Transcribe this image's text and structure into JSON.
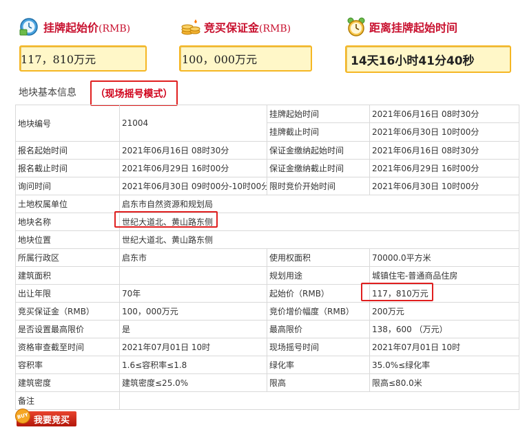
{
  "stats": [
    {
      "title": "挂牌起始价",
      "unit": "(RMB)",
      "value": "117，810万元",
      "icon": "money-clock-icon"
    },
    {
      "title": "竞买保证金",
      "unit": "(RMB)",
      "value": "100，000万元",
      "icon": "coin-stack-icon"
    },
    {
      "title": "距离挂牌起始时间",
      "unit": "",
      "value": "14天16小时41分40秒",
      "icon": "alarm-clock-icon"
    }
  ],
  "section": {
    "title": "地块基本信息",
    "mode": "（现场摇号模式）"
  },
  "table": {
    "parcel_no_label": "地块编号",
    "parcel_no": "21004",
    "listing_start_label": "挂牌起始时间",
    "listing_start": "2021年06月16日 08时30分",
    "listing_end_label": "挂牌截止时间",
    "listing_end": "2021年06月30日 10时00分",
    "rows": [
      {
        "l1": "报名起始时间",
        "v1": "2021年06月16日 08时30分",
        "l2": "保证金缴纳起始时间",
        "v2": "2021年06月16日 08时30分"
      },
      {
        "l1": "报名截止时间",
        "v1": "2021年06月29日 16时00分",
        "l2": "保证金缴纳截止时间",
        "v2": "2021年06月29日 16时00分"
      },
      {
        "l1": "询问时间",
        "v1": "2021年06月30日 09时00分-10时00分",
        "l2": "限时竞价开始时间",
        "v2": "2021年06月30日 10时00分"
      }
    ],
    "wide_rows": [
      {
        "l": "土地权属单位",
        "v": "启东市自然资源和规划局"
      },
      {
        "l": "地块名称",
        "v": "世纪大道北、黄山路东侧"
      },
      {
        "l": "地块位置",
        "v": "世纪大道北、黄山路东侧"
      }
    ],
    "rows2": [
      {
        "l1": "所属行政区",
        "v1": "启东市",
        "l2": "使用权面积",
        "v2": "70000.0平方米"
      },
      {
        "l1": "建筑面积",
        "v1": "",
        "l2": "规划用途",
        "v2": "城镇住宅-普通商品住房"
      },
      {
        "l1": "出让年限",
        "v1": "70年",
        "l2": "起始价（RMB）",
        "v2": "117，810万元"
      },
      {
        "l1": "竞买保证金（RMB）",
        "v1": "100，000万元",
        "l2": "竞价增价幅度（RMB）",
        "v2": "200万元"
      },
      {
        "l1": "是否设置最高限价",
        "v1": "是",
        "l2": "最高限价",
        "v2": "138，600 （万元）"
      },
      {
        "l1": "资格审查截至时间",
        "v1": "2021年07月01日 10时",
        "l2": "现场摇号时间",
        "v2": "2021年07月01日 10时"
      },
      {
        "l1": "容积率",
        "v1": "1.6≤容积率≤1.8",
        "l2": "绿化率",
        "v2": "35.0%≤绿化率"
      },
      {
        "l1": "建筑密度",
        "v1": "建筑密度≤25.0%",
        "l2": "限高",
        "v2": "限高≤80.0米"
      }
    ],
    "remarks_label": "备注",
    "remarks": ""
  },
  "bid_button": {
    "label": "我要竞买",
    "badge": "BUY"
  },
  "colors": {
    "accent_red": "#c8102e",
    "box_fill": "#fff7c8",
    "box_border": "#f5b623",
    "highlight": "#e01e1e"
  }
}
